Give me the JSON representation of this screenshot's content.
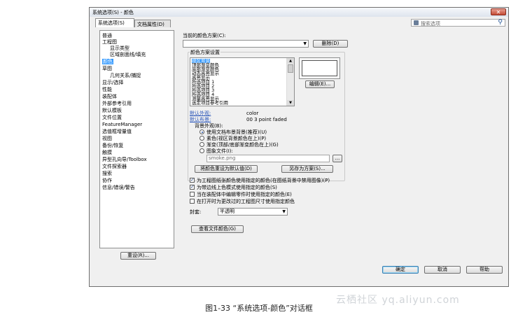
{
  "window": {
    "title": "系统选项(S) - 颜色",
    "close_label": "✕"
  },
  "tabs": [
    {
      "label": "系统选项(S)"
    },
    {
      "label": "文档属性(D)"
    }
  ],
  "search": {
    "placeholder": "搜索选项"
  },
  "tree": {
    "items": [
      {
        "label": "普通"
      },
      {
        "label": "工程图"
      },
      {
        "label": "显示类型"
      },
      {
        "label": "区域剖面线/填充"
      },
      {
        "label": "颜色"
      },
      {
        "label": "草图"
      },
      {
        "label": "几何关系/捕捉"
      },
      {
        "label": "显示/选择"
      },
      {
        "label": "性能"
      },
      {
        "label": "装配体"
      },
      {
        "label": "外部参考引用"
      },
      {
        "label": "默认模板"
      },
      {
        "label": "文件位置"
      },
      {
        "label": "FeatureManager"
      },
      {
        "label": "选值框增量值"
      },
      {
        "label": "视图"
      },
      {
        "label": "备份/恢复"
      },
      {
        "label": "触摸"
      },
      {
        "label": "异型孔向导/Toolbox"
      },
      {
        "label": "文件探索器"
      },
      {
        "label": "搜索"
      },
      {
        "label": "协作"
      },
      {
        "label": "信息/错误/警告"
      }
    ]
  },
  "reset_button": "重设(R)...",
  "scheme": {
    "label": "当前的颜色方案(C):",
    "value": "",
    "delete_button": "删除(D)"
  },
  "color_settings": {
    "group_label": "颜色方案设置",
    "items": [
      {
        "label": "视区背景"
      },
      {
        "label": "顶部渐变颜色"
      },
      {
        "label": "底部渐变颜色"
      },
      {
        "label": "动态高亮显示"
      },
      {
        "label": "高亮显示"
      },
      {
        "label": "所选项目 1"
      },
      {
        "label": "所选项目 2"
      },
      {
        "label": "所选项目 3"
      },
      {
        "label": "所选项目 4"
      },
      {
        "label": "测量高亮显示"
      },
      {
        "label": "选定项目参考引用"
      }
    ],
    "edit_button": "编辑(E)...",
    "default_appearance_label": "默认外观:",
    "default_appearance_value": "color",
    "default_scene_label": "默认布景:",
    "default_scene_value": "00 3 point faded"
  },
  "background": {
    "label": "背景外观(B):",
    "options": [
      {
        "label": "使用文档布景背景(推荐)(U)",
        "checked": true
      },
      {
        "label": "素色(视区背景颜色在上)(P)",
        "checked": false
      },
      {
        "label": "渐变(顶部/底部渐变颜色在上)(G)",
        "checked": false
      },
      {
        "label": "图象文件(I):",
        "checked": false
      }
    ],
    "image_file": "smoke.png",
    "browse_label": "..."
  },
  "buttons": {
    "reset_defaults": "将颜色重设为默认值(D)",
    "save_as": "另存为方案(S)..."
  },
  "checkboxes": [
    {
      "label": "为工程图纸张颜色使用指定的颜色(在图纸背景中禁用图像)(P)",
      "checked": true
    },
    {
      "label": "为带边线上色模式使用指定的颜色(S)",
      "checked": true
    },
    {
      "label": "当在装配体中编辑零件时使用指定的颜色(E)",
      "checked": false
    },
    {
      "label": "在打开时为更改过的工程图尺寸使用指定颜色",
      "checked": false
    }
  ],
  "envelope": {
    "label": "封套:",
    "value": "半透明"
  },
  "view_doc_colors": "查看文件颜色(G)",
  "footer": {
    "ok": "确定",
    "cancel": "取消",
    "help": "帮助"
  },
  "caption": "图1-33 “系统选项-颜色”对话框",
  "watermark": "云栖社区 yq.aliyun.com"
}
